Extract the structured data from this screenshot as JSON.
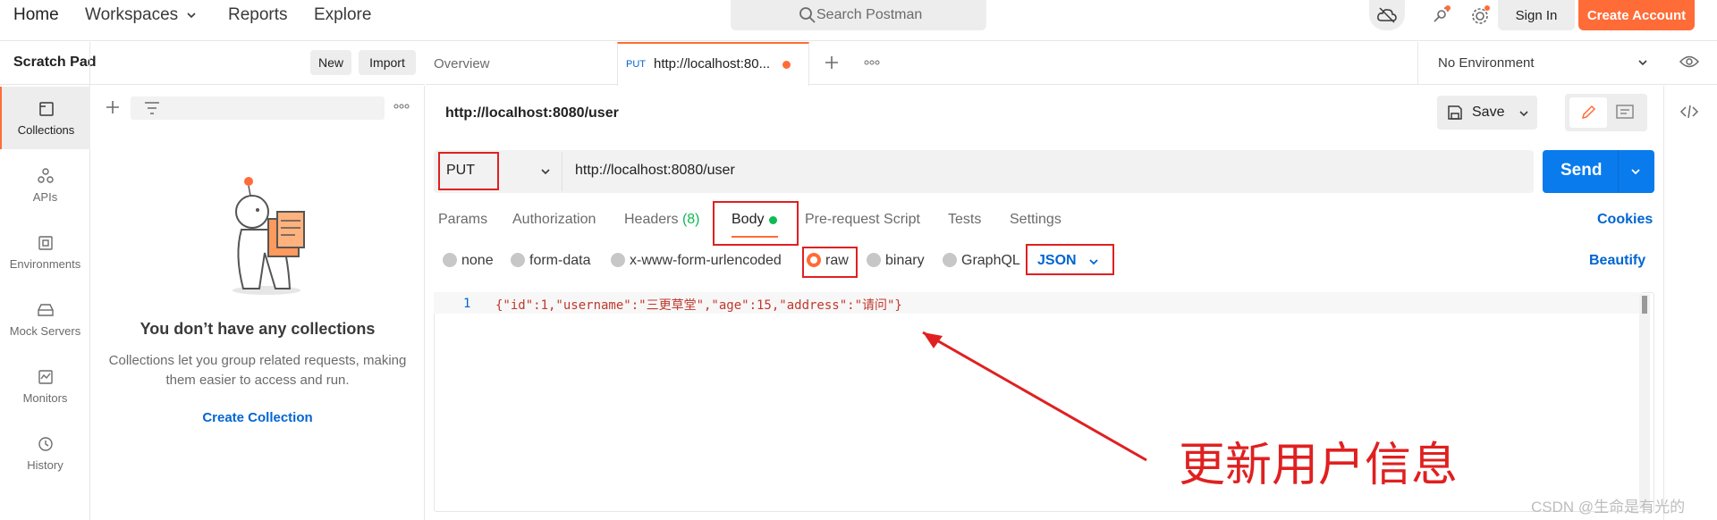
{
  "topbar": {
    "nav": [
      "Home",
      "Workspaces",
      "Reports",
      "Explore"
    ],
    "search_placeholder": "Search Postman",
    "sign_in": "Sign In",
    "create_account": "Create Account"
  },
  "sidebar": {
    "title": "Scratch Pad",
    "new_label": "New",
    "import_label": "Import",
    "items": [
      {
        "label": "Collections",
        "icon": "collections-icon"
      },
      {
        "label": "APIs",
        "icon": "apis-icon"
      },
      {
        "label": "Environments",
        "icon": "environments-icon"
      },
      {
        "label": "Mock Servers",
        "icon": "mock-servers-icon"
      },
      {
        "label": "Monitors",
        "icon": "monitors-icon"
      },
      {
        "label": "History",
        "icon": "history-icon"
      }
    ],
    "empty_title": "You don’t have any collections",
    "empty_desc": "Collections let you group related requests, making them easier to access and run.",
    "create_collection": "Create Collection"
  },
  "tabs": {
    "overview": "Overview",
    "active_method": "PUT",
    "active_url": "http://localhost:80...",
    "environment": "No Environment"
  },
  "request": {
    "title": "http://localhost:8080/user",
    "save_label": "Save",
    "method": "PUT",
    "url": "http://localhost:8080/user",
    "send_label": "Send",
    "tabs": [
      "Params",
      "Authorization",
      "Headers",
      "Body",
      "Pre-request Script",
      "Tests",
      "Settings"
    ],
    "headers_count": "(8)",
    "cookies": "Cookies",
    "body_options": [
      "none",
      "form-data",
      "x-www-form-urlencoded",
      "raw",
      "binary",
      "GraphQL"
    ],
    "body_format": "JSON",
    "beautify": "Beautify",
    "line_number": "1",
    "body_code": "{\"id\":1,\"username\":\"三更草堂\",\"age\":15,\"address\":\"请问\"}"
  },
  "annotation": "更新用户信息",
  "watermark": "CSDN @生命是有光的",
  "colors": {
    "accent": "#ff6c37",
    "send": "#097bed",
    "link": "#0265d2",
    "annotation": "#e02020"
  }
}
